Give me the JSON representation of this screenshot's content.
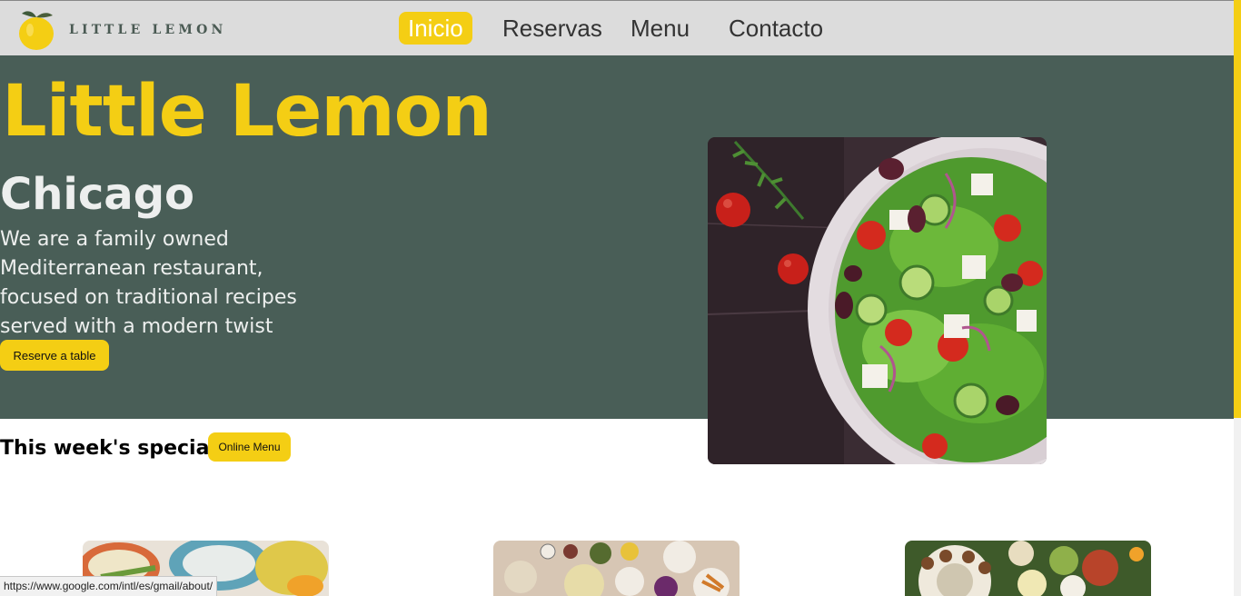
{
  "header": {
    "logo_text": "LITTLE LEMON",
    "nav": [
      {
        "label": "Inicio",
        "active": true
      },
      {
        "label": "Reservas",
        "active": false
      },
      {
        "label": "Menu",
        "active": false
      },
      {
        "label": "Contacto",
        "active": false
      }
    ]
  },
  "hero": {
    "title": "Little Lemon",
    "subtitle": "Chicago",
    "description": "We are a family owned Mediterranean restaurant, focused on traditional recipes served with a modern twist",
    "reserve_label": "Reserve a table"
  },
  "specials": {
    "title": "This week's specials!",
    "online_menu_label": "Online Menu"
  },
  "status_bar": {
    "url": "https://www.google.com/intl/es/gmail/about/"
  },
  "colors": {
    "primary_green": "#495e57",
    "primary_yellow": "#f4ce14",
    "light_text": "#edefee"
  }
}
